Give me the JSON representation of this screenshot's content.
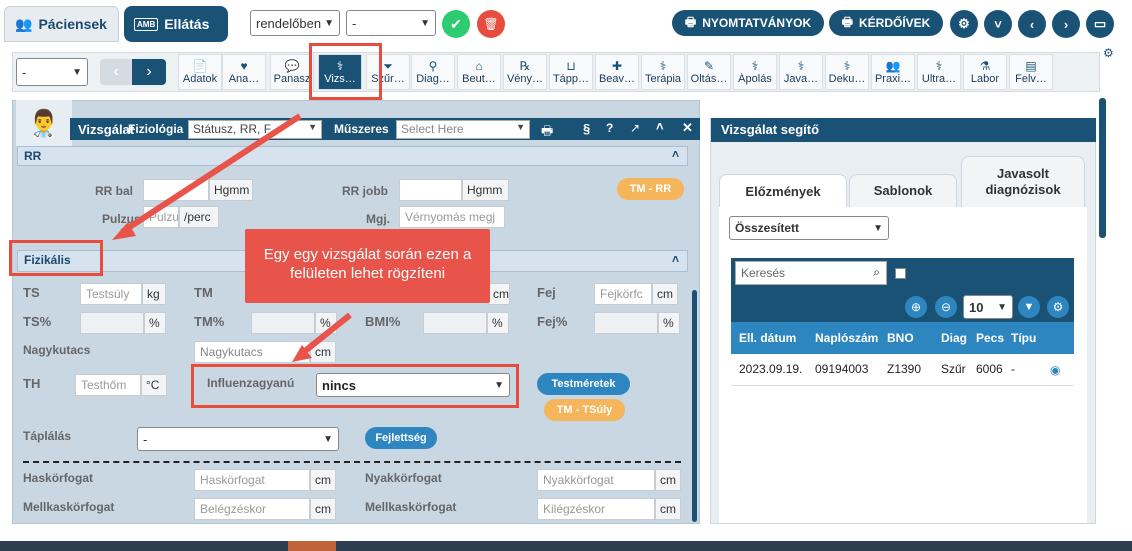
{
  "header": {
    "pacients": "Páciensek",
    "amb": "AMB",
    "ellatas": "Ellátás",
    "sel1": "rendelőben",
    "sel2": "-",
    "nyomtatvanyok": "NYOMTATVÁNYOK",
    "kerdoivek": "KÉRDŐÍVEK"
  },
  "toolbar": {
    "select": "-",
    "items": [
      "Adatok",
      "Ana…",
      "Panasz",
      "Vizs…",
      "Szűr…",
      "Diag…",
      "Beut…",
      "Vény…",
      "Tápp…",
      "Beav…",
      "Terápia",
      "Oltás…",
      "Ápolás",
      "Java…",
      "Deku…",
      "Praxi…",
      "Ultra…",
      "Labor",
      "Felv…"
    ]
  },
  "panel": {
    "title": "Vizsgálat",
    "fiziologia": "Fiziológia",
    "status_ph": "Státusz, RR, F",
    "muszeres": "Műszeres",
    "select_ph": "Select Here",
    "section": "§"
  },
  "rr": {
    "title": "RR",
    "rrbal": "RR bal",
    "hgmm1": "Hgmm",
    "rrjobb": "RR jobb",
    "hgmm2": "Hgmm",
    "tmrr": "TM - RR",
    "pulzus": "Pulzus",
    "pulzus_ph": "Pulzu",
    "perc": "/perc",
    "mgj": "Mgj.",
    "mgj_ph": "Vérnyomás megj"
  },
  "fiz": {
    "title": "Fizikális",
    "ts": "TS",
    "ts_ph": "Testsúly",
    "kg": "kg",
    "tm": "TM",
    "cm_tm": "cm",
    "fej": "Fej",
    "fej_ph": "Fejkörfc",
    "cm_fej": "cm",
    "tsp": "TS%",
    "pct1": "%",
    "tmp": "TM%",
    "pct2": "%",
    "bmi": "BMI%",
    "pct3": "%",
    "fejp": "Fej%",
    "pct4": "%",
    "nagykutacs": "Nagykutacs",
    "nagy_ph": "Nagykutacs",
    "cm_nk": "cm",
    "th": "TH",
    "th_ph": "Testhőm",
    "celsius": "°C",
    "influ": "Influenzagyanú",
    "influ_val": "nincs",
    "testmeretek": "Testméretek",
    "tmtsuly": "TM - TSúly",
    "taplalas": "Táplálás",
    "tapl_val": "-",
    "fejlettseg": "Fejlettség",
    "has": "Haskörfogat",
    "has_ph": "Haskörfogat",
    "cm_h": "cm",
    "nyak": "Nyakkörfogat",
    "nyak_ph": "Nyakkörfogat",
    "cm_ny": "cm",
    "mell": "Mellkaskörfogat",
    "bel_ph": "Belégzéskor",
    "cm_m1": "cm",
    "mell2": "Mellkaskörfogat",
    "kil_ph": "Kilégzéskor",
    "cm_m2": "cm"
  },
  "callout": "Egy egy vizsgálat során ezen a felületen lehet rögzíteni",
  "right": {
    "title": "Vizsgálat segítő",
    "tab1": "Előzmények",
    "tab2": "Sablonok",
    "tab3": "Javasolt diagnózisok",
    "select": "Összesített",
    "search_ph": "Keresés",
    "pagesize": "10",
    "cols": [
      "Ell. dátum",
      "Naplószám",
      "BNO",
      "Diag",
      "Pecs",
      "Típu"
    ],
    "row": [
      "2023.09.19.",
      "09194003",
      "Z1390",
      "Szűr",
      "6006",
      "-"
    ]
  }
}
